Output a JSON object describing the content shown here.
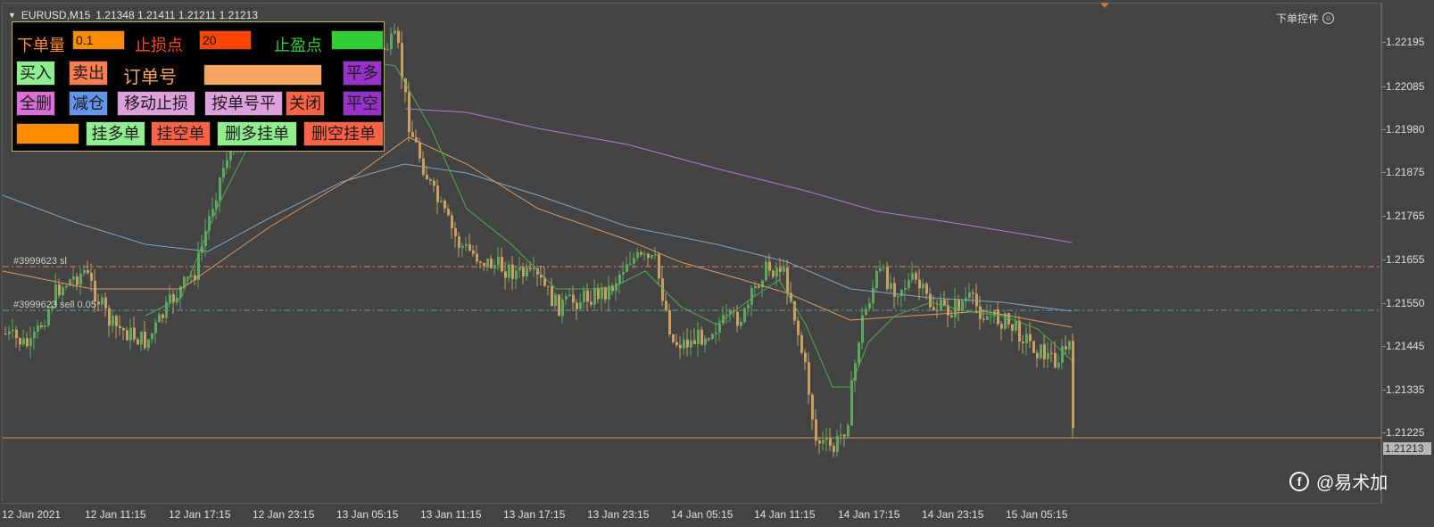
{
  "header": {
    "symbol": "EURUSD,M15",
    "ohlc": "1.21348 1.21411 1.21211 1.21213"
  },
  "top_right": {
    "label": "下单控件",
    "icon": "smile-icon"
  },
  "price_axis": {
    "labels": [
      "1.22195",
      "1.22085",
      "1.21980",
      "1.21875",
      "1.21765",
      "1.21655",
      "1.21550",
      "1.21445",
      "1.21335",
      "1.21225"
    ],
    "current_price": "1.21213"
  },
  "time_axis": {
    "labels": [
      "12 Jan 2021",
      "12 Jan 11:15",
      "12 Jan 17:15",
      "12 Jan 23:15",
      "13 Jan 05:15",
      "13 Jan 11:15",
      "13 Jan 17:15",
      "13 Jan 23:15",
      "14 Jan 05:15",
      "14 Jan 11:15",
      "14 Jan 17:15",
      "14 Jan 23:15",
      "15 Jan 05:15"
    ]
  },
  "order_lines": [
    {
      "label": "#3999623 sl",
      "color": "#e8865a"
    },
    {
      "label": "#3999623 sell 0.05",
      "color": "#6a9aa8"
    }
  ],
  "indicators": {
    "ma_slow_color": "#b57ad6",
    "ma_mid_color": "#7fa8c8",
    "ma_orange_color": "#e09a60",
    "ma_fast_color": "#4caf50",
    "candle_color": "#c8a060",
    "current_line_color": "#d89a55"
  },
  "panel": {
    "lot_label": "下单量",
    "lot_value": "0.1",
    "sl_label": "止损点",
    "sl_value": "20",
    "tp_label": "止盈点",
    "tp_value": "",
    "buy": "买入",
    "sell": "卖出",
    "ticket_label": "订单号",
    "ticket_value": "",
    "close_long": "平多",
    "delete_all": "全删",
    "reduce": "减仓",
    "trailing": "移动止损",
    "close_by_ticket": "按单号平",
    "close": "关闭",
    "close_short": "平空",
    "pending_value": "",
    "buy_limit": "挂多单",
    "sell_limit": "挂空单",
    "delete_buy_pending": "删多挂单",
    "delete_sell_pending": "删空挂单"
  },
  "watermark": {
    "text": "@易术加",
    "icon": "feather-icon"
  }
}
